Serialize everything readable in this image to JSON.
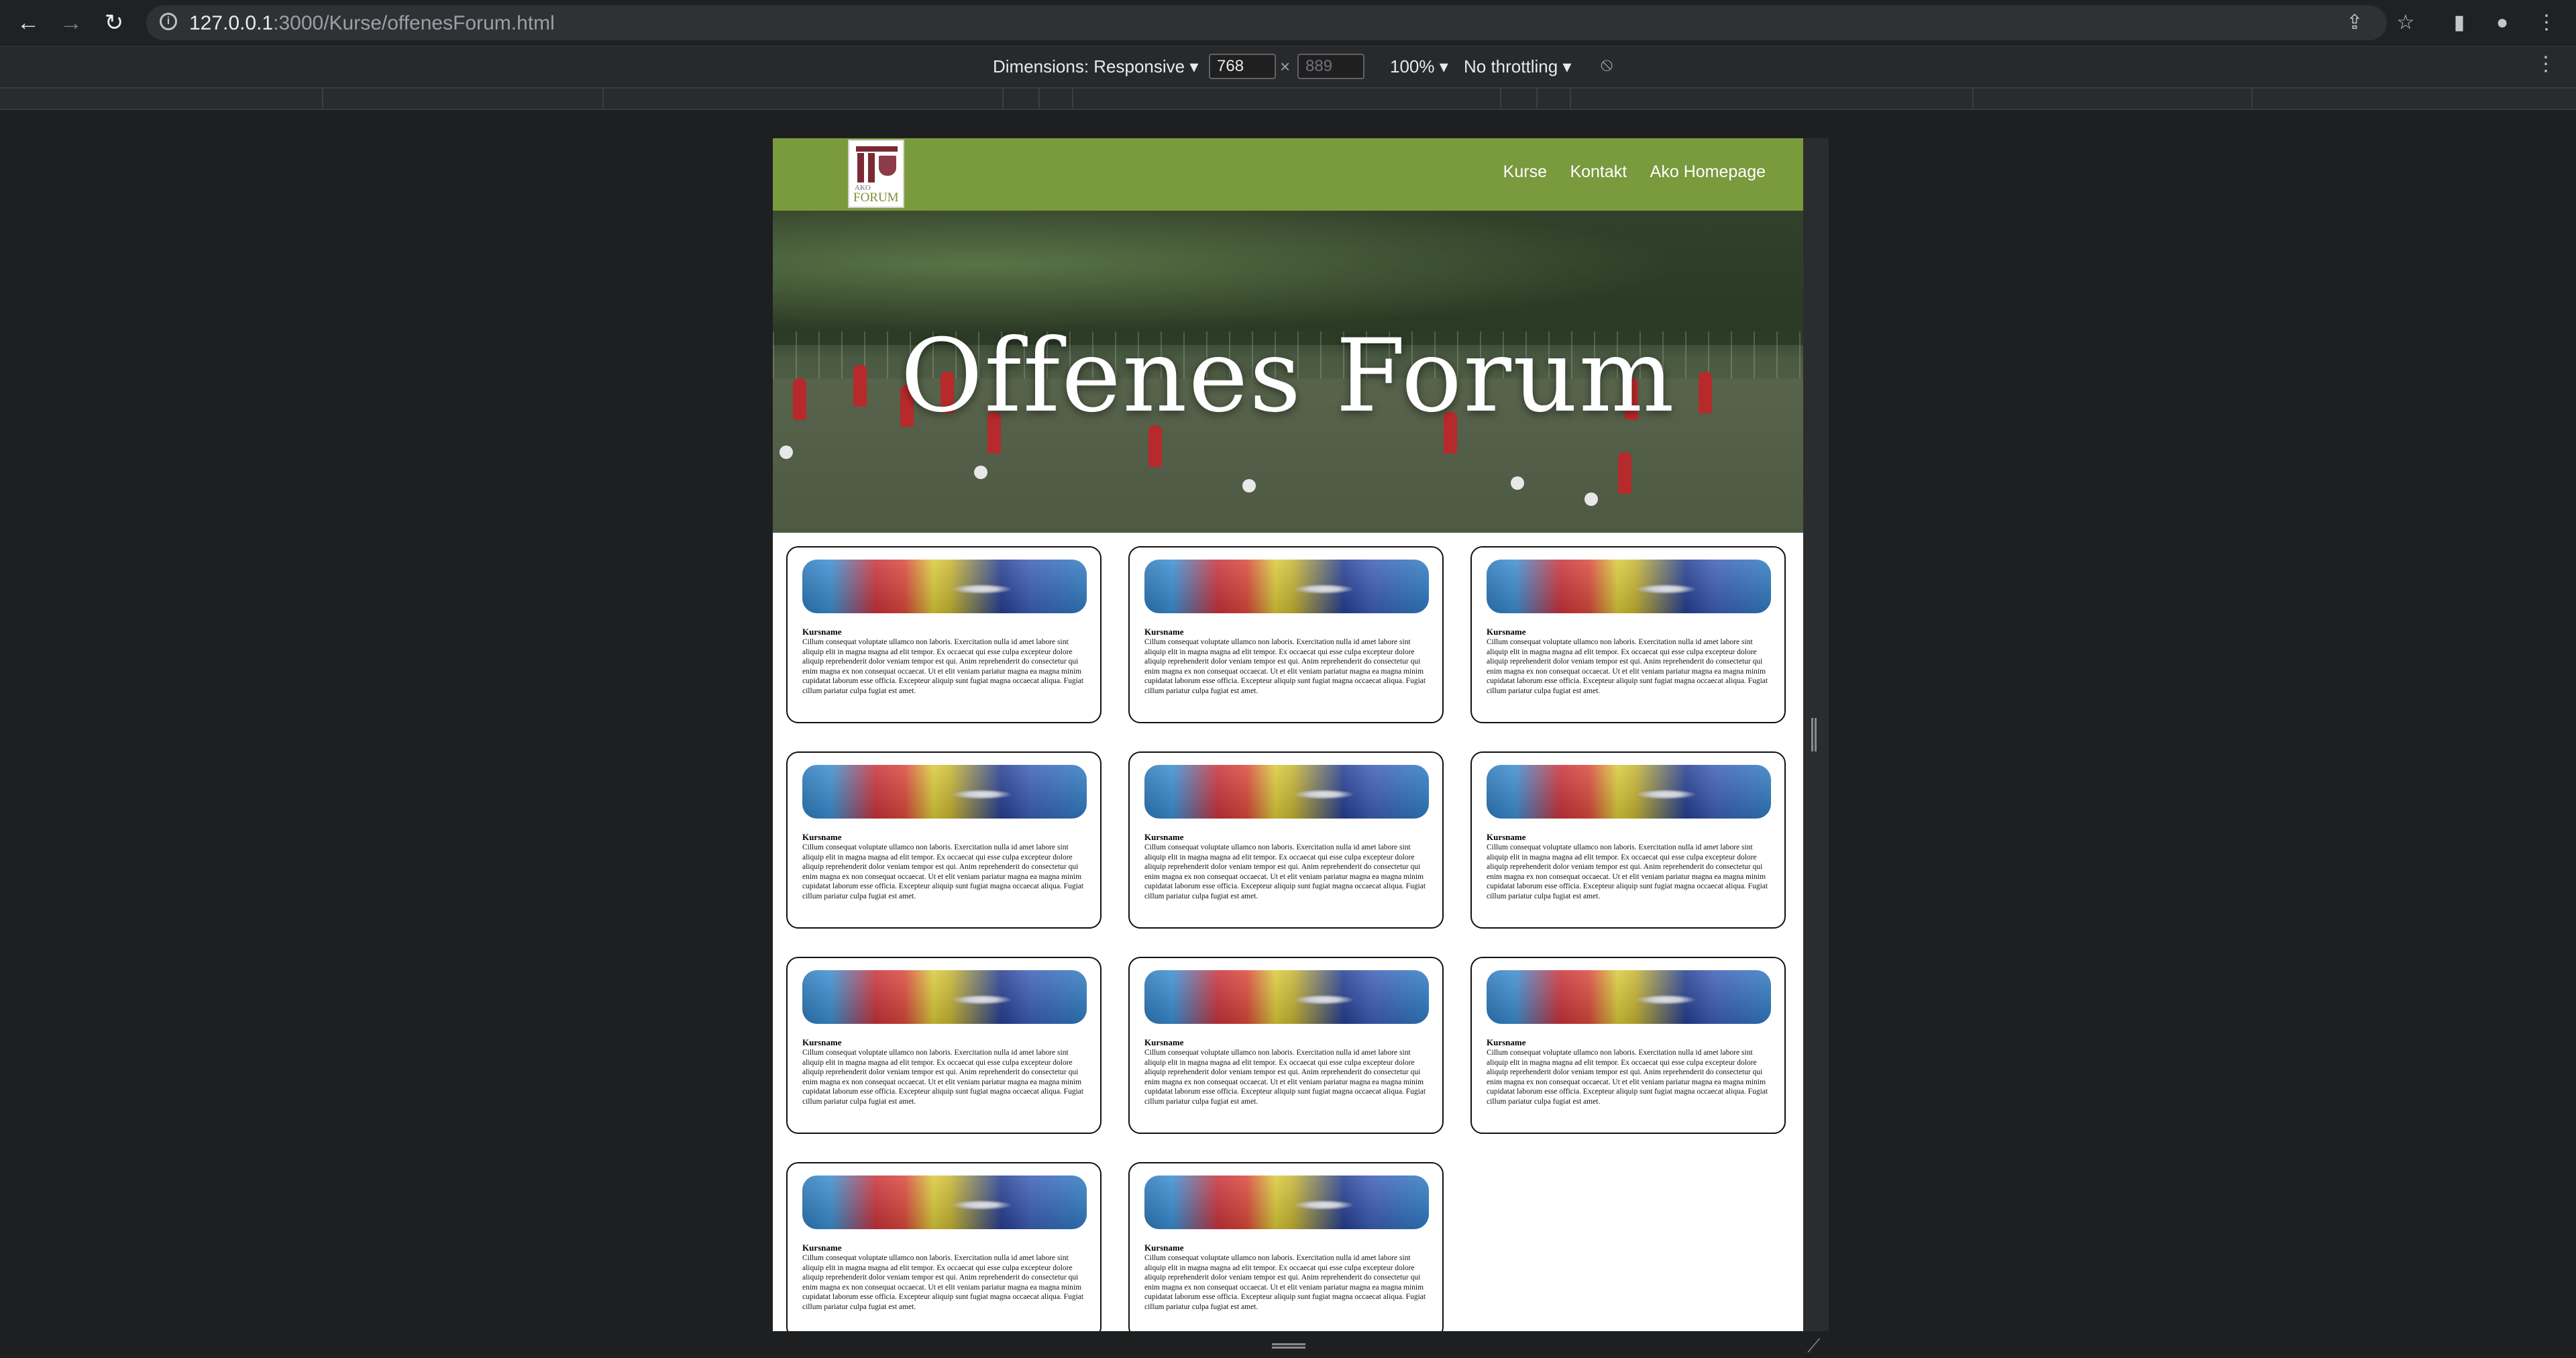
{
  "browser": {
    "url_host": "127.0.0.1",
    "url_path": ":3000/Kurse/offenesForum.html"
  },
  "devtools": {
    "dimensions_label": "Dimensions: Responsive ▾",
    "width_value": "768",
    "height_placeholder": "889",
    "times": "×",
    "zoom_label": "100% ▾",
    "throttle_label": "No throttling ▾"
  },
  "site": {
    "logo": {
      "line1": "AKO",
      "line2": "FORUM"
    },
    "nav": [
      "Kurse",
      "Kontakt",
      "Ako Homepage"
    ],
    "hero_title": "Offenes Forum"
  },
  "courses": [
    {
      "name": "Kursname",
      "desc": "Cillum consequat voluptate ullamco non laboris. Exercitation nulla id amet labore sint aliquip elit in magna magna ad elit tempor. Ex occaecat qui esse culpa excepteur dolore aliquip reprehenderit dolor veniam tempor est qui. Anim reprehenderit do consectetur qui enim magna ex non consequat occaecat. Ut et elit veniam pariatur magna ea magna minim cupidatat laborum esse officia. Excepteur aliquip sunt fugiat magna occaecat aliqua. Fugiat cillum pariatur culpa fugiat est amet."
    },
    {
      "name": "Kursname",
      "desc": "Cillum consequat voluptate ullamco non laboris. Exercitation nulla id amet labore sint aliquip elit in magna magna ad elit tempor. Ex occaecat qui esse culpa excepteur dolore aliquip reprehenderit dolor veniam tempor est qui. Anim reprehenderit do consectetur qui enim magna ex non consequat occaecat. Ut et elit veniam pariatur magna ea magna minim cupidatat laborum esse officia. Excepteur aliquip sunt fugiat magna occaecat aliqua. Fugiat cillum pariatur culpa fugiat est amet."
    },
    {
      "name": "Kursname",
      "desc": "Cillum consequat voluptate ullamco non laboris. Exercitation nulla id amet labore sint aliquip elit in magna magna ad elit tempor. Ex occaecat qui esse culpa excepteur dolore aliquip reprehenderit dolor veniam tempor est qui. Anim reprehenderit do consectetur qui enim magna ex non consequat occaecat. Ut et elit veniam pariatur magna ea magna minim cupidatat laborum esse officia. Excepteur aliquip sunt fugiat magna occaecat aliqua. Fugiat cillum pariatur culpa fugiat est amet."
    },
    {
      "name": "Kursname",
      "desc": "Cillum consequat voluptate ullamco non laboris. Exercitation nulla id amet labore sint aliquip elit in magna magna ad elit tempor. Ex occaecat qui esse culpa excepteur dolore aliquip reprehenderit dolor veniam tempor est qui. Anim reprehenderit do consectetur qui enim magna ex non consequat occaecat. Ut et elit veniam pariatur magna ea magna minim cupidatat laborum esse officia. Excepteur aliquip sunt fugiat magna occaecat aliqua. Fugiat cillum pariatur culpa fugiat est amet."
    },
    {
      "name": "Kursname",
      "desc": "Cillum consequat voluptate ullamco non laboris. Exercitation nulla id amet labore sint aliquip elit in magna magna ad elit tempor. Ex occaecat qui esse culpa excepteur dolore aliquip reprehenderit dolor veniam tempor est qui. Anim reprehenderit do consectetur qui enim magna ex non consequat occaecat. Ut et elit veniam pariatur magna ea magna minim cupidatat laborum esse officia. Excepteur aliquip sunt fugiat magna occaecat aliqua. Fugiat cillum pariatur culpa fugiat est amet."
    },
    {
      "name": "Kursname",
      "desc": "Cillum consequat voluptate ullamco non laboris. Exercitation nulla id amet labore sint aliquip elit in magna magna ad elit tempor. Ex occaecat qui esse culpa excepteur dolore aliquip reprehenderit dolor veniam tempor est qui. Anim reprehenderit do consectetur qui enim magna ex non consequat occaecat. Ut et elit veniam pariatur magna ea magna minim cupidatat laborum esse officia. Excepteur aliquip sunt fugiat magna occaecat aliqua. Fugiat cillum pariatur culpa fugiat est amet."
    },
    {
      "name": "Kursname",
      "desc": "Cillum consequat voluptate ullamco non laboris. Exercitation nulla id amet labore sint aliquip elit in magna magna ad elit tempor. Ex occaecat qui esse culpa excepteur dolore aliquip reprehenderit dolor veniam tempor est qui. Anim reprehenderit do consectetur qui enim magna ex non consequat occaecat. Ut et elit veniam pariatur magna ea magna minim cupidatat laborum esse officia. Excepteur aliquip sunt fugiat magna occaecat aliqua. Fugiat cillum pariatur culpa fugiat est amet."
    },
    {
      "name": "Kursname",
      "desc": "Cillum consequat voluptate ullamco non laboris. Exercitation nulla id amet labore sint aliquip elit in magna magna ad elit tempor. Ex occaecat qui esse culpa excepteur dolore aliquip reprehenderit dolor veniam tempor est qui. Anim reprehenderit do consectetur qui enim magna ex non consequat occaecat. Ut et elit veniam pariatur magna ea magna minim cupidatat laborum esse officia. Excepteur aliquip sunt fugiat magna occaecat aliqua. Fugiat cillum pariatur culpa fugiat est amet."
    },
    {
      "name": "Kursname",
      "desc": "Cillum consequat voluptate ullamco non laboris. Exercitation nulla id amet labore sint aliquip elit in magna magna ad elit tempor. Ex occaecat qui esse culpa excepteur dolore aliquip reprehenderit dolor veniam tempor est qui. Anim reprehenderit do consectetur qui enim magna ex non consequat occaecat. Ut et elit veniam pariatur magna ea magna minim cupidatat laborum esse officia. Excepteur aliquip sunt fugiat magna occaecat aliqua. Fugiat cillum pariatur culpa fugiat est amet."
    },
    {
      "name": "Kursname",
      "desc": "Cillum consequat voluptate ullamco non laboris. Exercitation nulla id amet labore sint aliquip elit in magna magna ad elit tempor. Ex occaecat qui esse culpa excepteur dolore aliquip reprehenderit dolor veniam tempor est qui. Anim reprehenderit do consectetur qui enim magna ex non consequat occaecat. Ut et elit veniam pariatur magna ea magna minim cupidatat laborum esse officia. Excepteur aliquip sunt fugiat magna occaecat aliqua. Fugiat cillum pariatur culpa fugiat est amet."
    },
    {
      "name": "Kursname",
      "desc": "Cillum consequat voluptate ullamco non laboris. Exercitation nulla id amet labore sint aliquip elit in magna magna ad elit tempor. Ex occaecat qui esse culpa excepteur dolore aliquip reprehenderit dolor veniam tempor est qui. Anim reprehenderit do consectetur qui enim magna ex non consequat occaecat. Ut et elit veniam pariatur magna ea magna minim cupidatat laborum esse officia. Excepteur aliquip sunt fugiat magna occaecat aliqua. Fugiat cillum pariatur culpa fugiat est amet."
    }
  ],
  "icons": {
    "back": "back-arrow-icon",
    "forward": "forward-arrow-icon",
    "reload": "reload-icon",
    "info": "site-info-icon",
    "share": "share-icon",
    "bookmark": "star-icon",
    "sidepanel": "side-panel-icon",
    "profile": "profile-icon",
    "menu": "kebab-menu-icon",
    "rotate": "rotate-icon"
  },
  "colors": {
    "nav_green": "#799a3d",
    "browser_bg": "#202124"
  }
}
